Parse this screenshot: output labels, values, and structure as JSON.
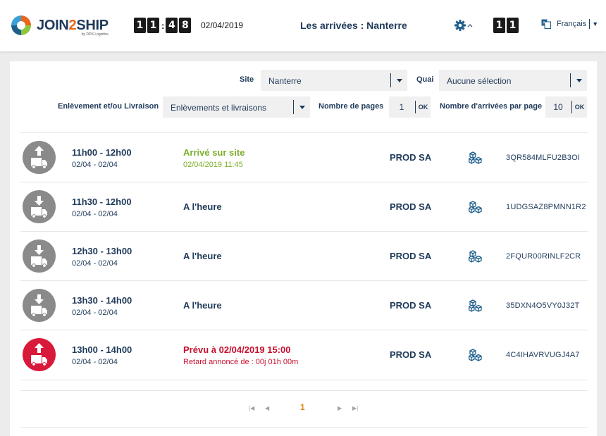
{
  "app": {
    "logo_text_a": "JOIN",
    "logo_text_b": "2",
    "logo_text_c": "SHIP",
    "logo_sub": "by DDS Logistics",
    "clock_digits": [
      "1",
      "1",
      "4",
      "8"
    ],
    "clock_sep": ":",
    "date": "02/04/2019",
    "title": "Les arrivées : Nanterre",
    "counter_digits": [
      "1",
      "1"
    ],
    "language": "Français"
  },
  "filters": {
    "site_label": "Site",
    "site_value": "Nanterre",
    "quai_label": "Quai",
    "quai_value": "Aucune sélection",
    "type_label": "Enlèvement et/ou Livraison",
    "type_value": "Enlèvements et livraisons",
    "pages_label": "Nombre de pages",
    "pages_value": "1",
    "per_page_label": "Nombre d'arrivées par page",
    "per_page_value": "10",
    "ok_label": "OK"
  },
  "arrivals": [
    {
      "direction": "up",
      "state": "grey",
      "time": "11h00 - 12h00",
      "range": "02/04 - 02/04",
      "status": "Arrivé sur site",
      "status_sub": "02/04/2019 11:45",
      "status_color": "#7cae2a",
      "company": "PROD SA",
      "ref": "3QR584MLFU2B3OI"
    },
    {
      "direction": "down",
      "state": "grey",
      "time": "11h30 - 12h00",
      "range": "02/04 - 02/04",
      "status": "A l'heure",
      "status_sub": "",
      "status_color": "#1f3a5a",
      "company": "PROD SA",
      "ref": "1UDGSAZ8PMNN1R2"
    },
    {
      "direction": "down",
      "state": "grey",
      "time": "12h30 - 13h00",
      "range": "02/04 - 02/04",
      "status": "A l'heure",
      "status_sub": "",
      "status_color": "#1f3a5a",
      "company": "PROD SA",
      "ref": "2FQUR00RINLF2CR"
    },
    {
      "direction": "down",
      "state": "grey",
      "time": "13h30 - 14h00",
      "range": "02/04 - 02/04",
      "status": "A l'heure",
      "status_sub": "",
      "status_color": "#1f3a5a",
      "company": "PROD SA",
      "ref": "35DXN4O5VY0J32T"
    },
    {
      "direction": "up",
      "state": "red",
      "time": "13h00 - 14h00",
      "range": "02/04 - 02/04",
      "status": "Prévu à 02/04/2019 15:00",
      "status_sub": "Retard annoncé de : 00j 01h 00m",
      "status_color": "#c8102e",
      "company": "PROD SA",
      "ref": "4C4IHAVRVUGJ4A7"
    }
  ],
  "pager": {
    "first_icon": "first-page-icon",
    "prev_icon": "prev-page-icon",
    "current": "1",
    "next_icon": "next-page-icon",
    "last_icon": "last-page-icon"
  },
  "colors": {
    "primary": "#1f3a5a",
    "accent": "#e48a1f",
    "arrived": "#7cae2a",
    "late": "#c8102e",
    "avatar_grey": "#8a8a8a",
    "avatar_red": "#d8193a"
  }
}
